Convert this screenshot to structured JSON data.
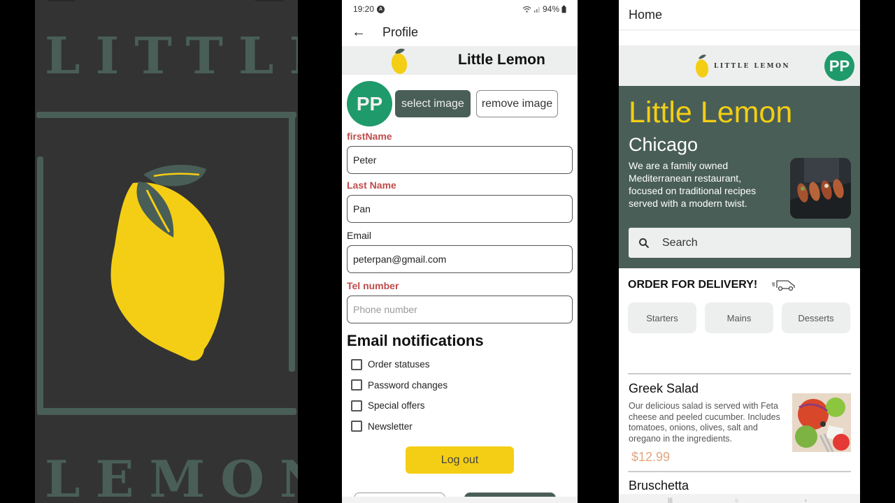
{
  "splash": {
    "word_top": "LITTLE",
    "word_bottom": "LEMON",
    "colors": {
      "background": "#333333",
      "green": "#495e57",
      "lemon": "#f4ce14"
    }
  },
  "profile": {
    "status": {
      "time": "19:20",
      "battery": "94%"
    },
    "appbar": {
      "back_icon": "arrow-left-icon",
      "title": "Profile"
    },
    "brand": {
      "name": "Little Lemon"
    },
    "avatar": {
      "initials": "PP"
    },
    "buttons": {
      "select_image": "select image",
      "remove_image": "remove image",
      "logout": "Log out"
    },
    "fields": [
      {
        "label": "firstName",
        "value": "Peter",
        "placeholder": "",
        "label_state": "error"
      },
      {
        "label": "Last Name",
        "value": "Pan",
        "placeholder": "",
        "label_state": "error"
      },
      {
        "label": "Email",
        "value": "peterpan@gmail.com",
        "placeholder": "",
        "label_state": "normal"
      },
      {
        "label": "Tel number",
        "value": "",
        "placeholder": "Phone number",
        "label_state": "error"
      }
    ],
    "notifications": {
      "title": "Email notifications",
      "options": [
        {
          "label": "Order statuses",
          "checked": false
        },
        {
          "label": "Password changes",
          "checked": false
        },
        {
          "label": "Special offers",
          "checked": false
        },
        {
          "label": "Newsletter",
          "checked": false
        }
      ]
    }
  },
  "home": {
    "top_title": "Home",
    "header": {
      "logo_text": "LITTLE LEMON",
      "avatar_initials": "PP"
    },
    "hero": {
      "title": "Little Lemon",
      "city": "Chicago",
      "description": "We are a family owned Mediterranean restaurant, focused on traditional recipes served with a modern twist.",
      "search_placeholder": "Search"
    },
    "delivery": {
      "title": "ORDER FOR DELIVERY!",
      "icon": "delivery-truck-icon"
    },
    "categories": [
      "Starters",
      "Mains",
      "Desserts"
    ],
    "menu": [
      {
        "name": "Greek Salad",
        "description": " Our delicious salad is served with Feta cheese and peeled cucumber. Includes tomatoes, onions, olives, salt and oregano in the ingredients.",
        "price": "$12.99"
      },
      {
        "name": "Bruschetta"
      }
    ]
  }
}
